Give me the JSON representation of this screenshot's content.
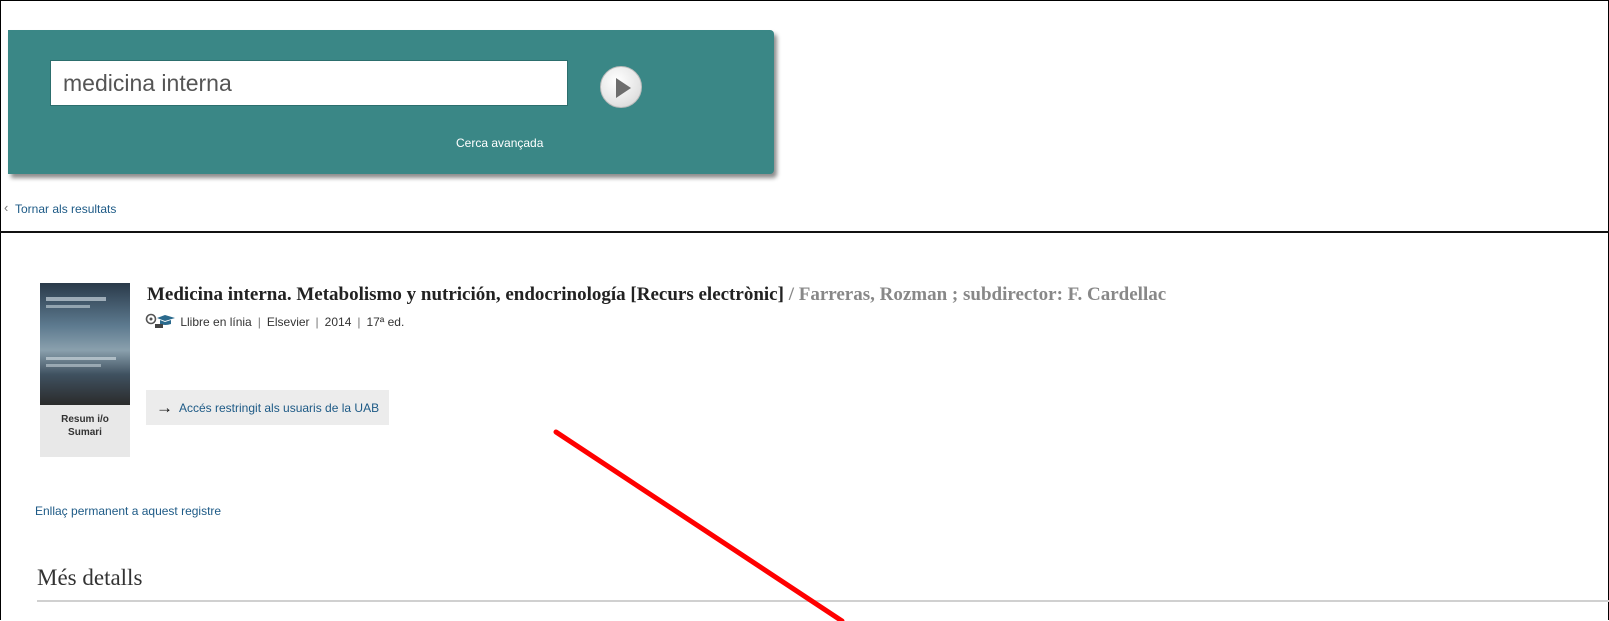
{
  "search": {
    "value": "medicina interna",
    "advanced_label": "Cerca avançada"
  },
  "nav": {
    "back_label": "Tornar als resultats"
  },
  "record": {
    "title": "Medicina interna. Metabolismo y nutrición, endocrinología [Recurs electrònic]",
    "author_statement": " / Farreras, Rozman ; subdirector: F. Cardellac",
    "format": "Llibre en línia",
    "publisher": "Elsevier",
    "year": "2014",
    "edition": "17ª ed.",
    "thumb_caption_line1": "Resum i/o",
    "thumb_caption_line2": "Sumari",
    "access_label": "Accés restringit als usuaris de la UAB",
    "icon": "online-book-icon"
  },
  "permalink_label": "Enllaç permanent a aquest registre",
  "details_heading": "Més detalls",
  "colors": {
    "search_panel": "#3a8786",
    "link": "#1d5a86",
    "annotation": "#ff0000"
  }
}
